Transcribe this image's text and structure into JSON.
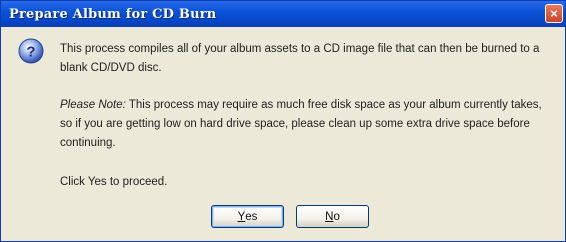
{
  "window": {
    "title": "Prepare Album for CD Burn",
    "close_glyph": "×"
  },
  "icon": {
    "name": "question-icon",
    "glyph": "?"
  },
  "message": {
    "paragraph1": "This process compiles all of your album assets to a CD image file that can then be burned to a blank CD/DVD disc.",
    "note_label": "Please Note:",
    "note_text": " This process may require as much free disk space as your album currently takes, so if you are getting low on hard drive space, please clean up some extra drive space before continuing.",
    "prompt": "Click Yes to proceed."
  },
  "buttons": {
    "yes": {
      "accel": "Y",
      "rest": "es"
    },
    "no": {
      "accel": "N",
      "rest": "o"
    }
  },
  "colors": {
    "titlebar": "#0a53d8",
    "dialog_bg": "#ece9d8",
    "close": "#c9442a"
  }
}
